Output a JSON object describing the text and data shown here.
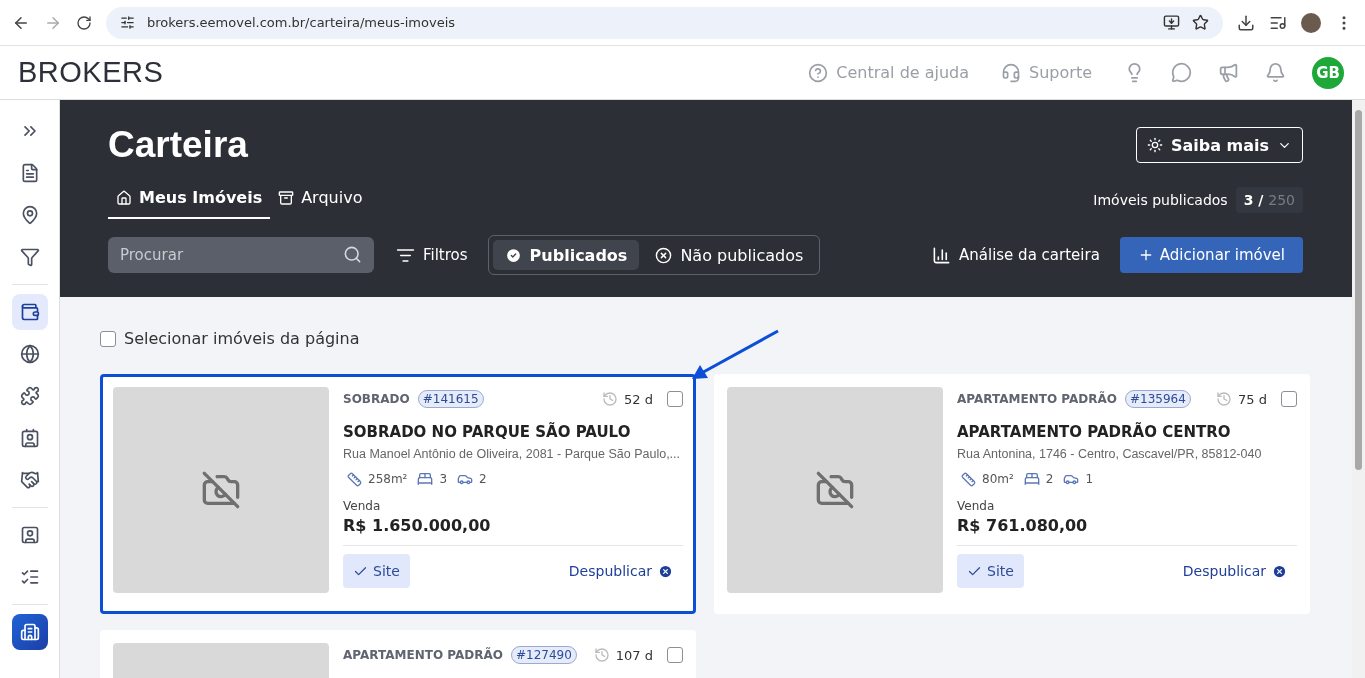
{
  "browser": {
    "url": "brokers.eemovel.com.br/carteira/meus-imoveis"
  },
  "header": {
    "logo": "BROKERS",
    "help_link": "Central de ajuda",
    "support_link": "Suporte",
    "avatar": "GB"
  },
  "sidebar": {
    "groups": [
      [
        {
          "kind": "expand",
          "selected": false
        },
        {
          "kind": "invoice",
          "selected": false
        },
        {
          "kind": "pin",
          "selected": false
        },
        {
          "kind": "funnel",
          "selected": false
        }
      ],
      [
        {
          "kind": "wallet",
          "selected": true
        },
        {
          "kind": "globe",
          "selected": false
        },
        {
          "kind": "puzzle",
          "selected": false
        },
        {
          "kind": "contact",
          "selected": false
        },
        {
          "kind": "handshake",
          "selected": false
        }
      ],
      [
        {
          "kind": "calendar",
          "selected": false
        },
        {
          "kind": "checklist",
          "selected": false
        }
      ],
      [
        {
          "kind": "building"
        }
      ]
    ]
  },
  "page": {
    "title": "Carteira",
    "help_button": "Saiba mais",
    "tabs": [
      {
        "label": "Meus Imóveis",
        "selected": true
      },
      {
        "label": "Arquivo",
        "selected": false
      }
    ],
    "published_count": {
      "label": "Imóveis publicados",
      "value": "3 /",
      "total": "250"
    },
    "search": {
      "placeholder": "Procurar"
    },
    "filters_button": "Filtros",
    "status_toggle": [
      {
        "label": "Publicados",
        "selected": true
      },
      {
        "label": "Não publicados",
        "selected": false
      }
    ],
    "analysis_button": "Análise da carteira",
    "add_button": "Adicionar imóvel"
  },
  "select_page": {
    "label": "Selecionar imóveis da página",
    "checked": false
  },
  "properties": [
    {
      "type": "SOBRADO",
      "code": "#141615",
      "age": "52 d",
      "checked": false,
      "highlighted": true,
      "title": "SOBRADO NO PARQUE SÃO PAULO",
      "address": "Rua Manoel Antônio de Oliveira, 2081 - Parque São Paulo,...",
      "area": "258m²",
      "bedrooms": "3",
      "parking": "2",
      "deal": "Venda",
      "price": "R$ 1.650.000,00",
      "site_button": "Site",
      "unpublish_link": "Despublicar"
    },
    {
      "type": "APARTAMENTO PADRÃO",
      "code": "#135964",
      "age": "75 d",
      "checked": false,
      "highlighted": false,
      "title": "APARTAMENTO PADRÃO CENTRO",
      "address": "Rua Antonina, 1746 - Centro, Cascavel/PR, 85812-040",
      "area": "80m²",
      "bedrooms": "2",
      "parking": "1",
      "deal": "Venda",
      "price": "R$ 761.080,00",
      "site_button": "Site",
      "unpublish_link": "Despublicar"
    },
    {
      "type": "APARTAMENTO PADRÃO",
      "code": "#127490",
      "age": "107 d",
      "checked": false,
      "highlighted": false
    }
  ]
}
